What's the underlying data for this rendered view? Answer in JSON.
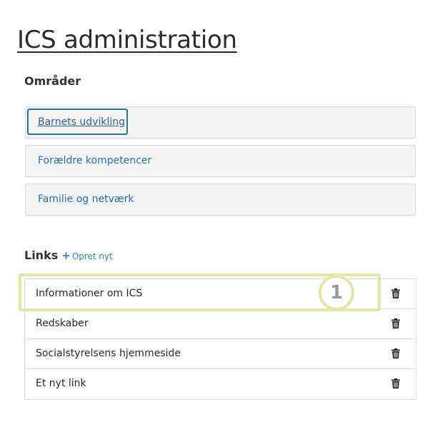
{
  "page": {
    "title": "ICS administration"
  },
  "areas": {
    "heading": "Områder",
    "items": [
      {
        "label": "Barnets udvikling",
        "active": true
      },
      {
        "label": "Forældre kompetencer",
        "active": false
      },
      {
        "label": "Familie og netværk",
        "active": false
      }
    ]
  },
  "links": {
    "heading": "Links",
    "create_label": "Opret nyt",
    "items": [
      {
        "label": "Informationer om ICS"
      },
      {
        "label": "Redskaber"
      },
      {
        "label": "Socialstyrelsens hjemmeside"
      },
      {
        "label": "Et nyt link"
      }
    ]
  },
  "annotation": {
    "step_number": "1",
    "color": "#e4e6a6"
  },
  "colors": {
    "link": "#2e6da4",
    "area_background": "#f4f4f4"
  },
  "icons": {
    "create": "plus-icon",
    "delete": "trash-icon"
  }
}
